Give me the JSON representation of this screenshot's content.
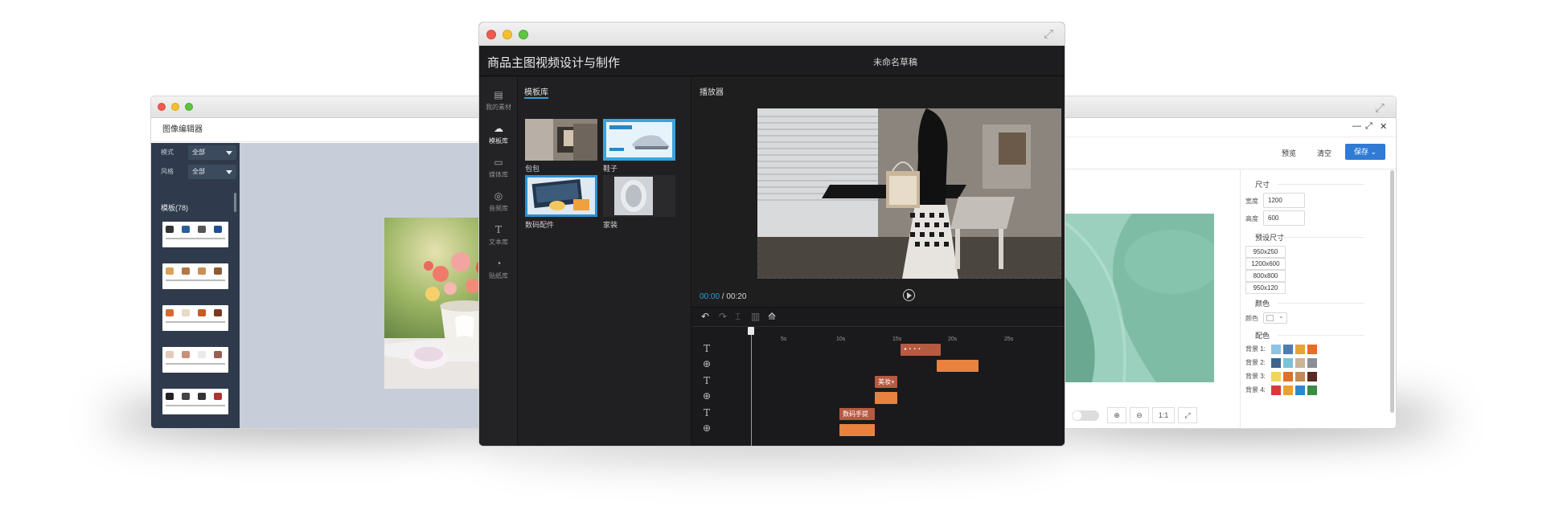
{
  "left_window": {
    "app_title": "图像编辑器",
    "filter_labels": [
      "模式",
      "风格"
    ],
    "filter_values": [
      "全部",
      "全部"
    ],
    "template_count": "模板(78)"
  },
  "right_window": {
    "toolbar": {
      "preview": "预览",
      "clear": "清空",
      "save": "保存"
    },
    "zoom": {
      "in_icon": "zoom-in-icon",
      "out_icon": "zoom-out-icon",
      "ratio": "1:1",
      "fit_icon": "fit-icon"
    },
    "size_section": "尺寸",
    "width_label": "宽度",
    "width_value": "1200",
    "height_label": "高度",
    "height_value": "600",
    "preset_section": "预设尺寸",
    "presets": [
      "950x250",
      "1200x600",
      "800x800",
      "950x120"
    ],
    "color_section": "颜色",
    "color_label": "颜色",
    "palette_section": "配色",
    "palettes": [
      {
        "label": "背景 1:",
        "colors": [
          "#8ec3e4",
          "#4a7fae",
          "#e4a437",
          "#e86a2c"
        ]
      },
      {
        "label": "背景 2:",
        "colors": [
          "#3f6388",
          "#7cc1d8",
          "#c9b49a",
          "#8a8f96"
        ]
      },
      {
        "label": "背景 3:",
        "colors": [
          "#f0d55b",
          "#e06f2a",
          "#c28a54",
          "#5a2a22"
        ]
      },
      {
        "label": "背景 4:",
        "colors": [
          "#d8393a",
          "#eaa12c",
          "#2f86c9",
          "#3a8b45"
        ]
      }
    ]
  },
  "center_window": {
    "app_title": "商品主图视频设计与制作",
    "draft_name": "未命名草稿",
    "rail": [
      {
        "label": "我的素材",
        "icon": "layout-icon"
      },
      {
        "label": "模板库",
        "icon": "cloud-icon"
      },
      {
        "label": "媒体库",
        "icon": "video-icon"
      },
      {
        "label": "音频库",
        "icon": "music-icon"
      },
      {
        "label": "文本库",
        "icon": "text-icon"
      },
      {
        "label": "贴纸库",
        "icon": "sticker-icon"
      }
    ],
    "library_tab": "模板库",
    "library_items": [
      "包包",
      "鞋子",
      "数码配件",
      "家装"
    ],
    "player_label": "播放器",
    "time_current": "00:00",
    "time_total": "00:20",
    "ruler_ticks": [
      "5s",
      "10s",
      "15s",
      "20s",
      "25s"
    ],
    "clips": [
      "美妆+",
      "数码手提"
    ],
    "accent_color": "#2d9fd8"
  }
}
